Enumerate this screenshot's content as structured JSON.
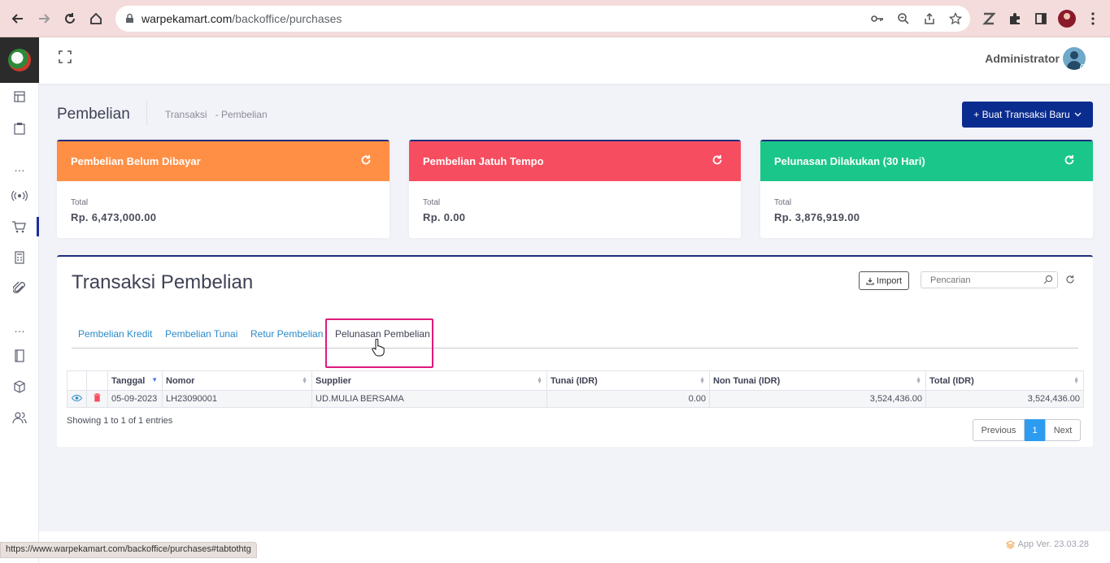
{
  "browser": {
    "url_domain": "warpekamart.com",
    "url_path": "/backoffice/purchases",
    "status_url": "https://www.warpekamart.com/backoffice/purchases#tabtothtg"
  },
  "topbar": {
    "user_name": "Administrator"
  },
  "subheader": {
    "title": "Pembelian",
    "crumb_1": "Transaksi",
    "crumb_sep": "-",
    "crumb_2": "Pembelian",
    "new_button": "+ Buat Transaksi Baru"
  },
  "cards": [
    {
      "title": "Pembelian Belum Dibayar",
      "label": "Total",
      "value": "Rp. 6,473,000.00",
      "color": "#ff8f45"
    },
    {
      "title": "Pembelian Jatuh Tempo",
      "label": "Total",
      "value": "Rp. 0.00",
      "color": "#f64e60"
    },
    {
      "title": "Pelunasan Dilakukan (30 Hari)",
      "label": "Total",
      "value": "Rp. 3,876,919.00",
      "color": "#1bc68a"
    }
  ],
  "panel": {
    "title": "Transaksi Pembelian",
    "import_label": "Import",
    "search_placeholder": "Pencarian"
  },
  "tabs": [
    {
      "label": "Pembelian Kredit"
    },
    {
      "label": "Pembelian Tunai"
    },
    {
      "label": "Retur Pembelian"
    },
    {
      "label": "Pelunasan Pembelian"
    }
  ],
  "table": {
    "headers": [
      "Tanggal",
      "Nomor",
      "Supplier",
      "Tunai (IDR)",
      "Non Tunai (IDR)",
      "Total (IDR)"
    ],
    "rows": [
      {
        "tanggal": "05-09-2023",
        "nomor": "LH23090001",
        "supplier": "UD.MULIA BERSAMA",
        "tunai": "0.00",
        "non_tunai": "3,524,436.00",
        "total": "3,524,436.00"
      }
    ],
    "info": "Showing 1 to 1 of 1 entries",
    "pager": {
      "prev": "Previous",
      "page": "1",
      "next": "Next"
    }
  },
  "footer": {
    "version": "App Ver. 23.03.28"
  },
  "colors": {
    "accent": "#0b2c8f",
    "link": "#2b8ac9",
    "highlight": "#e0197d"
  }
}
